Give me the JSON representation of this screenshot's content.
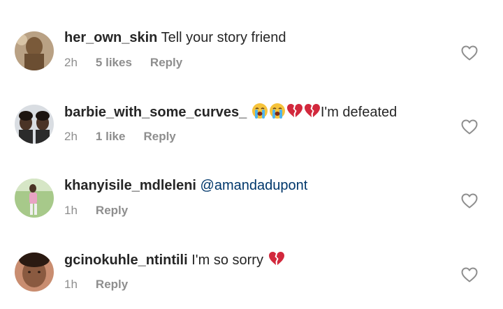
{
  "comments": [
    {
      "username": "her_own_skin",
      "text": " Tell your story friend",
      "time": "2h",
      "likes": "5 likes",
      "reply": "Reply",
      "avatar": "avatar-photo-1"
    },
    {
      "username": "barbie_with_some_curves_",
      "text": "I'm defeated",
      "emojis": [
        "loudly-crying-face",
        "loudly-crying-face",
        "broken-heart",
        "broken-heart"
      ],
      "time": "2h",
      "likes": "1 like",
      "reply": "Reply",
      "avatar": "avatar-photo-2"
    },
    {
      "username": "khanyisile_mdleleni",
      "mention": " @amandadupont",
      "time": "1h",
      "reply": "Reply",
      "avatar": "avatar-photo-3"
    },
    {
      "username": "gcinokuhle_ntintili",
      "text": " I'm so sorry",
      "emojis": [
        "broken-heart"
      ],
      "time": "1h",
      "reply": "Reply",
      "avatar": "avatar-photo-4"
    }
  ],
  "icons": {
    "like": "heart-outline-icon"
  },
  "colors": {
    "text": "#262626",
    "meta": "#8e8e8e",
    "mention": "#00376b",
    "broken_heart": "#d2283c",
    "crying_face": "#f6c33b"
  }
}
